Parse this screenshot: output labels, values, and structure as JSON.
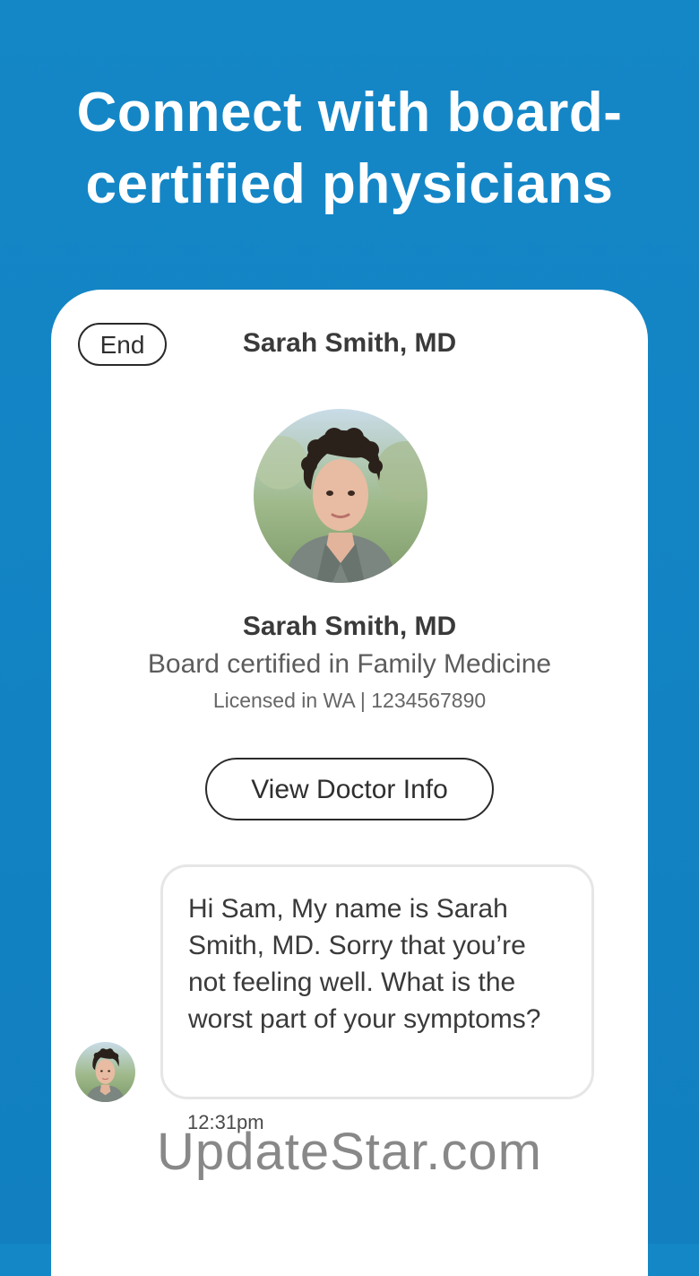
{
  "headline": {
    "line1": "Connect with board-",
    "line2": "certified physicians"
  },
  "chat_header": {
    "end_label": "End",
    "doctor_name": "Sarah Smith, MD"
  },
  "doctor_profile": {
    "name": "Sarah Smith, MD",
    "specialty": "Board certified in Family Medicine",
    "license": "Licensed in WA | 1234567890",
    "view_info_label": "View Doctor Info"
  },
  "message": {
    "text": "Hi Sam, My name is Sarah Smith, MD. Sorry that you’re not feeling well. What is the worst part of your symptoms?",
    "time": "12:31pm"
  },
  "watermark": "UpdateStar.com",
  "colors": {
    "background": "#1487c7",
    "card": "#ffffff",
    "text_dark": "#3a3a3a",
    "bubble_border": "#e6e6e6"
  }
}
